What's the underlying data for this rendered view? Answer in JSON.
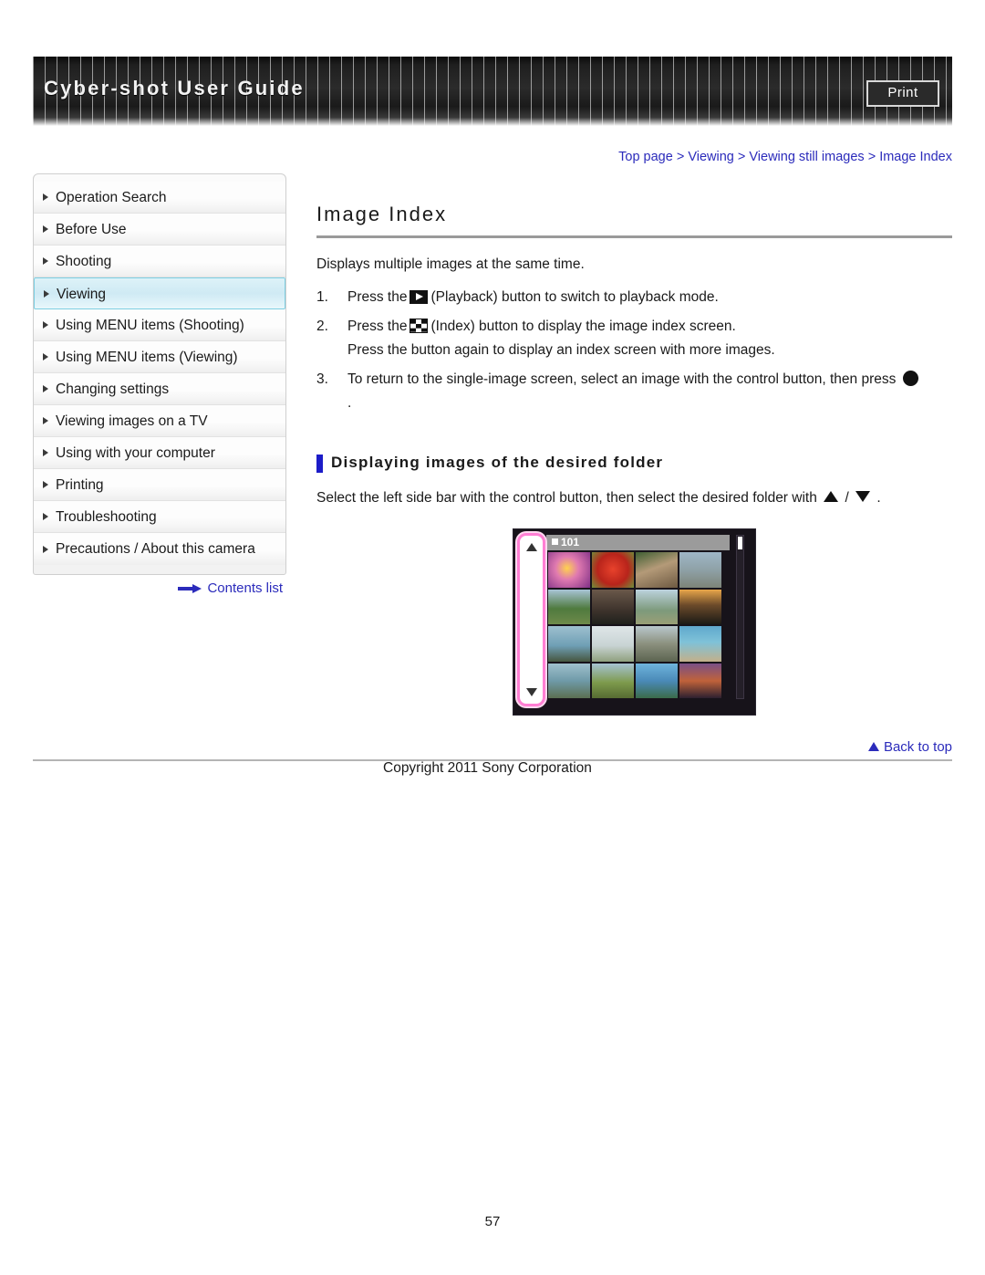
{
  "header": {
    "title": "Cyber-shot User Guide",
    "print_label": "Print"
  },
  "breadcrumb": {
    "items": [
      "Top page",
      "Viewing",
      "Viewing still images",
      "Image Index"
    ],
    "separator": ">",
    "full_text": "Top page > Viewing > Viewing still images > Image Index"
  },
  "sidebar": {
    "items": [
      {
        "label": "Operation Search",
        "active": false
      },
      {
        "label": "Before Use",
        "active": false
      },
      {
        "label": "Shooting",
        "active": false
      },
      {
        "label": "Viewing",
        "active": true
      },
      {
        "label": "Using MENU items (Shooting)",
        "active": false
      },
      {
        "label": "Using MENU items (Viewing)",
        "active": false
      },
      {
        "label": "Changing settings",
        "active": false
      },
      {
        "label": "Viewing images on a TV",
        "active": false
      },
      {
        "label": "Using with your computer",
        "active": false
      },
      {
        "label": "Printing",
        "active": false
      },
      {
        "label": "Troubleshooting",
        "active": false
      },
      {
        "label": "Precautions / About this camera",
        "active": false
      }
    ],
    "contents_link": "Contents list"
  },
  "main": {
    "title": "Image Index",
    "intro": "Displays multiple images at the same time.",
    "steps": [
      {
        "number": "1.",
        "before_icon": "Press the",
        "icon": "playback-icon",
        "after_icon": "(Playback) button to switch to playback mode.",
        "extra": ""
      },
      {
        "number": "2.",
        "before_icon": "Press the",
        "icon": "index-icon",
        "after_icon": "(Index) button to display the image index screen.",
        "extra": "Press the button again to display an index screen with more images."
      },
      {
        "number": "3.",
        "before_icon": "To return to the single-image screen, select an image with the control button, then press",
        "icon": "center-button-icon",
        "after_icon": "",
        "extra": "."
      }
    ],
    "subsection": {
      "heading": "Displaying images of the desired folder",
      "text_before": "Select the left side bar with the control button, then select the desired folder with",
      "up_icon": "up-triangle-icon",
      "slash": "/",
      "down_icon": "down-triangle-icon",
      "text_after": "."
    },
    "illustration": {
      "folder_label": "101",
      "up_arrow": "up-triangle-icon",
      "down_arrow": "down-triangle-icon",
      "thumbnails": [
        "#8e3f8f",
        "#c03224",
        "#7a6a55",
        "#8aa4ae",
        "#6d8f5a",
        "#5a4434",
        "#7f9ab2",
        "#2b3a2a",
        "#8fa9b6",
        "#b9c2c4",
        "#8d8f7c",
        "#4c8fb5",
        "#6f94a4",
        "#7b9a55",
        "#5d8fc0",
        "#5b3f62"
      ]
    }
  },
  "footer": {
    "back_to_top": "Back to top",
    "copyright": "Copyright 2011 Sony Corporation",
    "page_number": "57"
  },
  "colors": {
    "link": "#2b2bbb",
    "accent_bar": "#1c1cc8",
    "active_item": "#cfeaf4",
    "highlight_pink": "#ff7fd4"
  }
}
